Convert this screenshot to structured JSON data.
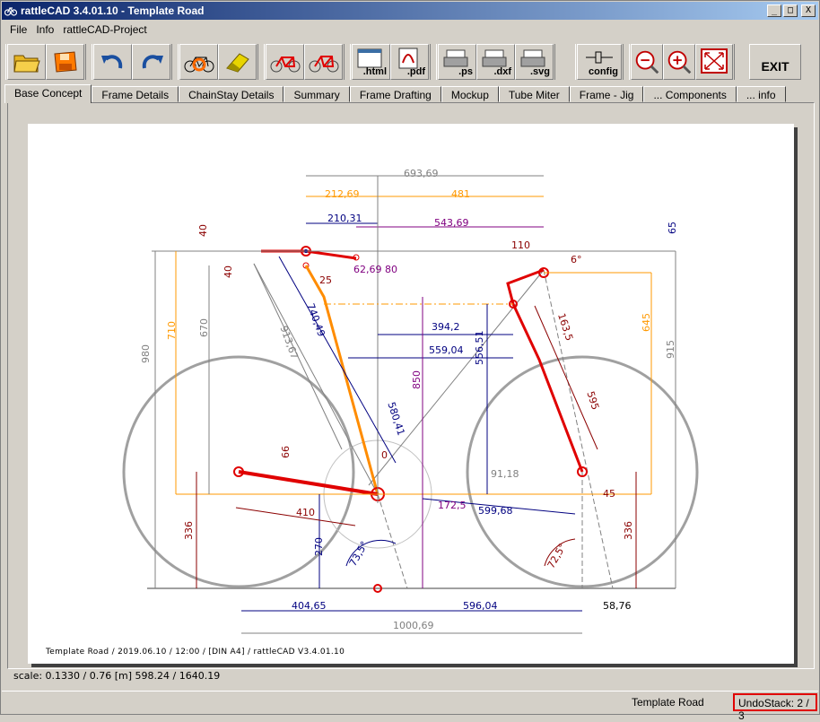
{
  "window": {
    "title": "rattleCAD  3.4.01.10 - Template Road",
    "minimize": "_",
    "maximize": "□",
    "close": "X"
  },
  "menu": [
    "File",
    "Info",
    "rattleCAD-Project"
  ],
  "toolbar": {
    "html_label": ".html",
    "pdf_label": ".pdf",
    "ps_label": ".ps",
    "dxf_label": ".dxf",
    "svg_label": ".svg",
    "config_label": "config",
    "exit_label": "EXIT"
  },
  "tabs": [
    "Base Concept",
    "Frame Details",
    "ChainStay Details",
    "Summary",
    "Frame Drafting",
    "Mockup",
    "Tube Miter",
    "Frame - Jig",
    "... Components",
    "... info"
  ],
  "drawing": {
    "dims": {
      "d693": "693,69",
      "d212": "212,69",
      "d481": "481",
      "d210": "210,31",
      "d543": "543,69",
      "d65": "65",
      "d40a": "40",
      "d40b": "40",
      "d110": "110",
      "d6": "6°",
      "d6269": "62,69",
      "d80": "80",
      "d25": "25",
      "d740": "740,49",
      "d913": "913,67",
      "d710": "710",
      "d670": "670",
      "d980": "980",
      "d394": "394,2",
      "d559": "559,04",
      "d556": "556,51",
      "d850": "850",
      "d645": "645",
      "d915": "915",
      "d1635": "163,5",
      "d595": "595",
      "d580": "580,41",
      "d0": "0",
      "d66": "66",
      "d9118": "91,18",
      "d45": "45",
      "d410": "410",
      "d1725": "172,5",
      "d599": "599,68",
      "d336a": "336",
      "d336b": "336",
      "d270": "270",
      "d735": "73,5°",
      "d725": "72,5°",
      "d404": "404,65",
      "d596": "596,04",
      "d5876": "58,76",
      "d1000": "1000,69"
    },
    "footer": "Template Road   /   2019.06.10 / 12:00   /  [DIN A4]  /   rattleCAD   V3.4.01.10",
    "colors": {
      "frame": "#e00000",
      "tube": "#ff8c00",
      "dim_dark": "#8b0000",
      "dim_orange": "#ff9900",
      "dim_purple": "#800080",
      "dim_navy": "#000080",
      "wheel": "#a0a0a0",
      "grey_dim": "#808080"
    }
  },
  "scale": "scale: 0.1330 / 0.76  [m]  598.24 / 1640.19",
  "status": {
    "document": "Template Road",
    "undo": "UndoStack:  2 /  3"
  }
}
